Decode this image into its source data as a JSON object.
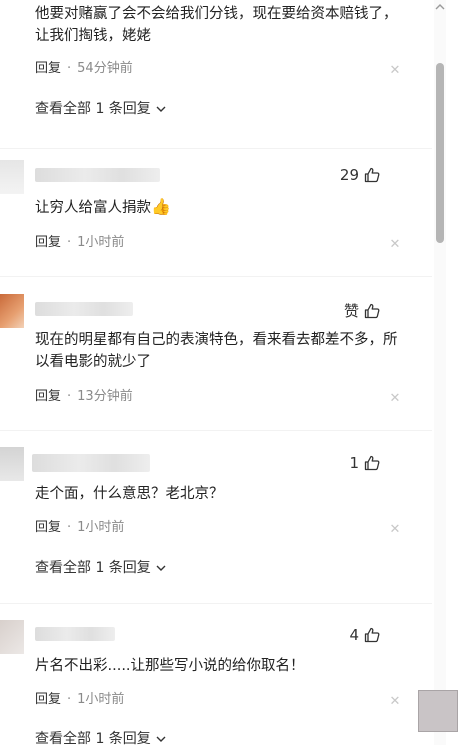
{
  "comments": [
    {
      "text": "他要对赌赢了会不会给我们分钱，现在要给资本赔钱了，让我们掏钱，姥姥",
      "reply_label": "回复",
      "time": "54分钟前",
      "view_replies": "查看全部 1 条回复"
    },
    {
      "likes": "29",
      "text": "让穷人给富人捐款",
      "emoji": "👍",
      "reply_label": "回复",
      "time": "1小时前"
    },
    {
      "likes": "赞",
      "text": "现在的明星都有自己的表演特色，看来看去都差不多，所以看电影的就少了",
      "reply_label": "回复",
      "time": "13分钟前"
    },
    {
      "likes": "1",
      "text": "走个面，什么意思？老北京？",
      "reply_label": "回复",
      "time": "1小时前",
      "view_replies": "查看全部 1 条回复"
    },
    {
      "likes": "4",
      "text": "片名不出彩.....让那些写小说的给你取名！",
      "reply_label": "回复",
      "time": "1小时前",
      "view_replies": "查看全部 1 条回复"
    }
  ],
  "icons": {
    "close": "close-icon",
    "like": "thumbs-up-icon",
    "chevron": "chevron-down-icon"
  },
  "colors": {
    "text": "#222222",
    "muted": "#8a8a8a",
    "scrollbar_thumb": "#b5b5b5"
  }
}
